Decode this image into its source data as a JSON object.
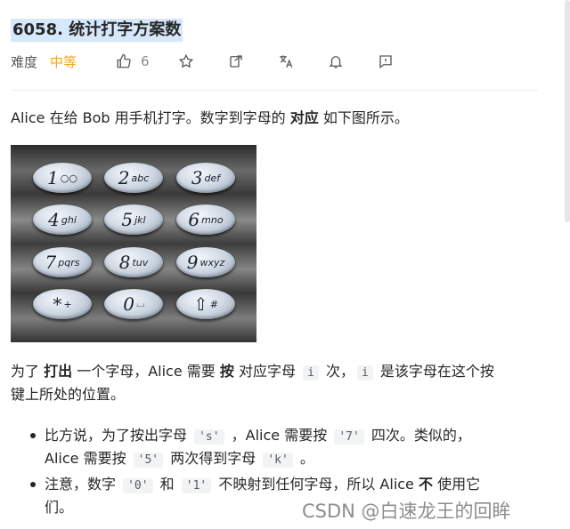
{
  "problem": {
    "title": "6058. 统计打字方案数"
  },
  "meta": {
    "difficulty_label": "难度",
    "difficulty_value": "中等",
    "likes": "6",
    "difficulty_color": "#f5a623"
  },
  "description": {
    "p1_a": "Alice 在给 Bob 用手机打字。数字到字母的 ",
    "p1_b": "对应",
    "p1_c": " 如下图所示。",
    "p2_a": "为了 ",
    "p2_b": "打出",
    "p2_c": " 一个字母，Alice 需要 ",
    "p2_d": "按",
    "p2_e": " 对应字母 ",
    "p2_code1": "i",
    "p2_f": " 次，",
    "p2_code2": "i",
    "p2_g": " 是该字母在这个按",
    "p2_line2": "键上所处的位置。",
    "b1_a": "比方说，为了按出字母 ",
    "b1_code1": "'s'",
    "b1_b": " ，Alice 需要按 ",
    "b1_code2": "'7'",
    "b1_c": " 四次。类似的，",
    "b1_d": "Alice 需要按 ",
    "b1_code3": "'5'",
    "b1_e": " 两次得到字母 ",
    "b1_code4": "'k'",
    "b1_f": " 。",
    "b2_a": "注意，数字 ",
    "b2_code1": "'0'",
    "b2_b": " 和 ",
    "b2_code2": "'1'",
    "b2_c": " 不映射到任何字母，所以 Alice ",
    "b2_d": "不",
    "b2_e": " 使用它",
    "b2_line2": "们。"
  },
  "keypad": {
    "keys": [
      {
        "digit": "1",
        "letters": "○○"
      },
      {
        "digit": "2",
        "letters": "abc"
      },
      {
        "digit": "3",
        "letters": "def"
      },
      {
        "digit": "4",
        "letters": "ghi"
      },
      {
        "digit": "5",
        "letters": "jkl"
      },
      {
        "digit": "6",
        "letters": "mno"
      },
      {
        "digit": "7",
        "letters": "pqrs"
      },
      {
        "digit": "8",
        "letters": "tuv"
      },
      {
        "digit": "9",
        "letters": "wxyz"
      },
      {
        "digit": "*",
        "letters": "+"
      },
      {
        "digit": "0",
        "letters": "⌴"
      },
      {
        "digit": "⇧",
        "letters": "#"
      }
    ]
  },
  "watermark": "CSDN @白速龙王的回眸"
}
